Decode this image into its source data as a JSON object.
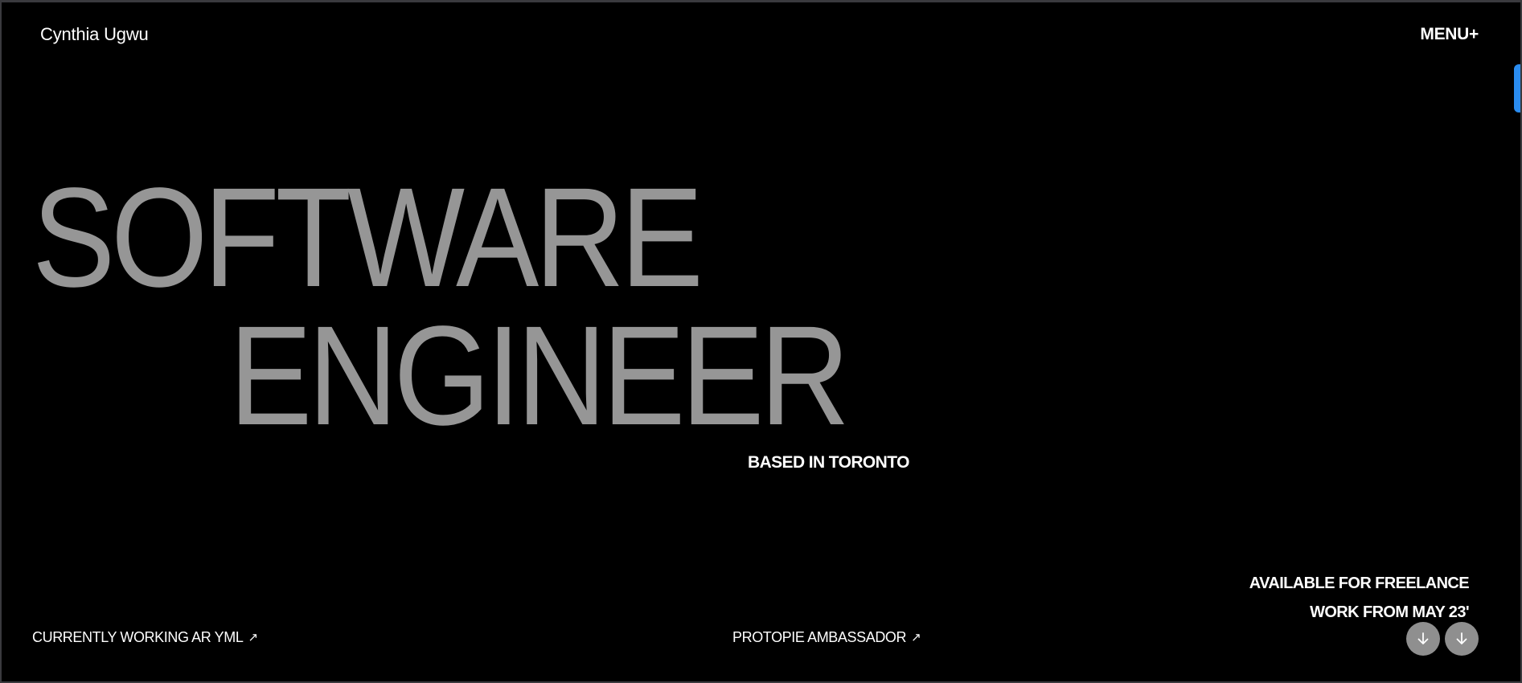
{
  "header": {
    "brand": "Cynthia Ugwu",
    "menu_label": "MENU+"
  },
  "hero": {
    "line1": "SOFTWARE",
    "line2": "ENGINEER",
    "location": "BASED IN TORONTO"
  },
  "availability": {
    "line1": "AVAILABLE FOR FREELANCE",
    "line2": "WORK FROM MAY 23'"
  },
  "footer": {
    "left_link": "CURRENTLY WORKING AR YML",
    "center_link": "PROTOPIE AMBASSADOR",
    "link_icon": "↗"
  },
  "icons": {
    "external": "arrow-up-right-icon",
    "scroll": "arrow-down-icon"
  },
  "colors": {
    "background": "#000000",
    "hero_text": "#969696",
    "text": "#ffffff",
    "button": "#8f8f8f",
    "scrollbar": "#2a8cf0"
  }
}
